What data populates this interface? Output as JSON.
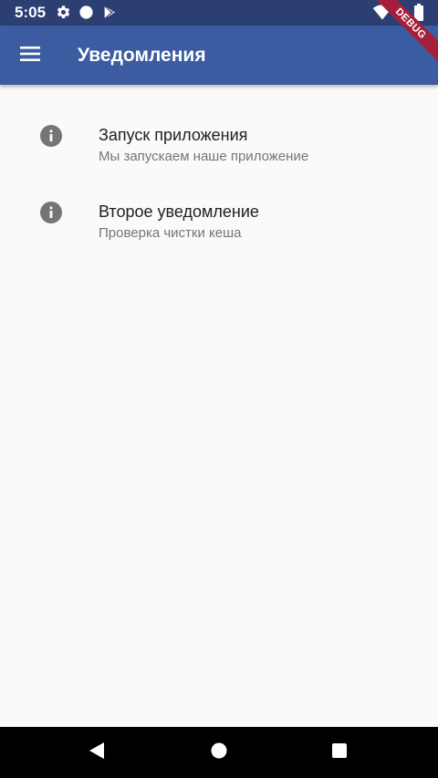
{
  "status_bar": {
    "time": "5:05",
    "icons": [
      "gear-icon",
      "circle-icon",
      "play-store-icon",
      "wifi-icon",
      "battery-icon"
    ]
  },
  "app_bar": {
    "menu_icon": "hamburger-menu-icon",
    "title": "Уведомления"
  },
  "debug_banner": "DEBUG",
  "notifications": [
    {
      "icon": "info-icon",
      "title": "Запуск приложения",
      "subtitle": "Мы запускаем наше приложение"
    },
    {
      "icon": "info-icon",
      "title": "Второе уведомление",
      "subtitle": "Проверка чистки кеша"
    }
  ],
  "nav_bar": {
    "buttons": [
      "back-icon",
      "home-icon",
      "recents-icon"
    ]
  },
  "colors": {
    "status_bar": "#2c3f73",
    "app_bar": "#3c5ca2",
    "background": "#fafafa",
    "icon_gray": "#757575",
    "debug_ribbon": "#a51f3a"
  }
}
